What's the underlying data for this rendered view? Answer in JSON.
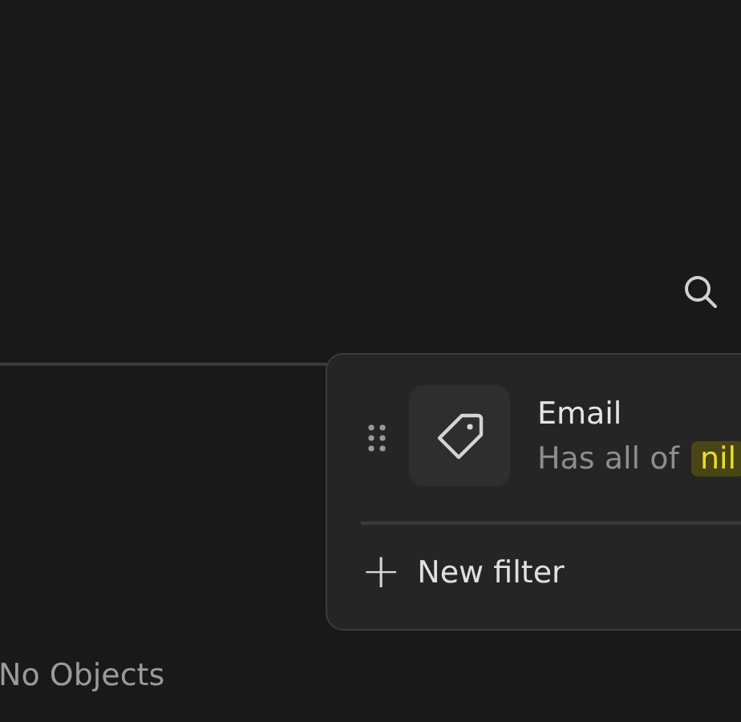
{
  "filter_popover": {
    "filters": [
      {
        "field": "Email",
        "condition": "Has all of",
        "value": "nil"
      }
    ],
    "new_filter": {
      "icon": "+",
      "label": "New filter"
    }
  },
  "empty_state": {
    "title": "No Objects"
  }
}
